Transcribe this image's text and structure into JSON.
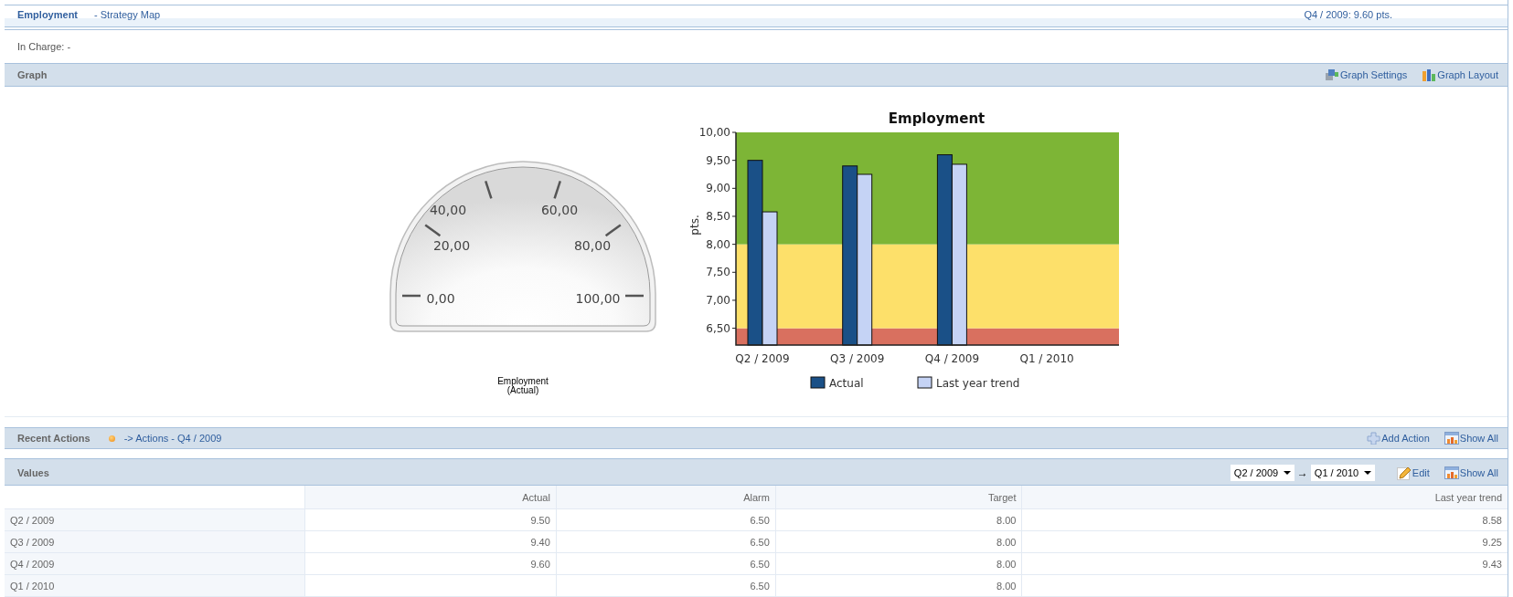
{
  "header": {
    "title": "Employment",
    "link": "- Strategy Map",
    "status": "Q4 / 2009: 9.60 pts."
  },
  "in_charge": "In Charge: -",
  "graph_section": {
    "title": "Graph",
    "actions": [
      {
        "kind": "settings",
        "label": "Graph Settings"
      },
      {
        "kind": "layout",
        "label": "Graph Layout"
      }
    ]
  },
  "gauge": {
    "labels": [
      "0,00",
      "20,00",
      "40,00",
      "60,00",
      "80,00",
      "100,00"
    ],
    "caption_lines": [
      "Employment",
      "(Actual)"
    ]
  },
  "chart": {
    "chart_data": {
      "type": "bar",
      "title": "Employment",
      "ylabel": "pts.",
      "categories": [
        "Q2 / 2009",
        "Q3 / 2009",
        "Q4 / 2009",
        "Q1 / 2010"
      ],
      "series": [
        {
          "name": "Actual",
          "color": "#1a5087",
          "values": [
            9.5,
            9.4,
            9.6,
            null
          ]
        },
        {
          "name": "Last year trend",
          "color": "#c5d3f5",
          "values": [
            8.58,
            9.25,
            9.43,
            null
          ]
        }
      ],
      "ylim": [
        6.2,
        10
      ],
      "yticks": [
        {
          "value": 6.5,
          "label": "6,50"
        },
        {
          "value": 7,
          "label": "7,00"
        },
        {
          "value": 7.5,
          "label": "7,50"
        },
        {
          "value": 8,
          "label": "8,00"
        },
        {
          "value": 8.5,
          "label": "8,50"
        },
        {
          "value": 9,
          "label": "9,00"
        },
        {
          "value": 9.5,
          "label": "9,50"
        },
        {
          "value": 10,
          "label": "10,00"
        }
      ],
      "legend": true,
      "bands": [
        {
          "axis": "y",
          "from": 6.2,
          "to": 6.5,
          "color": "#d9705f"
        },
        {
          "axis": "y",
          "from": 6.5,
          "to": 8,
          "color": "#fde06a"
        },
        {
          "axis": "y",
          "from": 8,
          "to": 10,
          "color": "#7db536"
        }
      ]
    }
  },
  "recent_actions": {
    "title": "Recent Actions",
    "link": "-> Actions - Q4 / 2009",
    "actions": [
      {
        "kind": "add",
        "label": "Add Action"
      },
      {
        "kind": "show_all",
        "label": "Show All"
      }
    ]
  },
  "values": {
    "title": "Values",
    "range_from": "Q2 / 2009",
    "range_arrow": "→",
    "range_to": "Q1 / 2010",
    "actions": [
      {
        "kind": "edit",
        "label": "Edit"
      },
      {
        "kind": "show_all",
        "label": "Show All"
      }
    ],
    "columns": [
      {
        "label": "Actual"
      },
      {
        "label": "Alarm"
      },
      {
        "label": "Target"
      },
      {
        "label": "Last year trend"
      }
    ],
    "rows": [
      {
        "period": "Q2 / 2009",
        "cells": [
          "9.50",
          "6.50",
          "8.00",
          "8.58"
        ]
      },
      {
        "period": "Q3 / 2009",
        "cells": [
          "9.40",
          "6.50",
          "8.00",
          "9.25"
        ]
      },
      {
        "period": "Q4 / 2009",
        "cells": [
          "9.60",
          "6.50",
          "8.00",
          "9.43"
        ]
      },
      {
        "period": "Q1 / 2010",
        "cells": [
          null,
          "6.50",
          "8.00",
          null
        ]
      }
    ]
  }
}
